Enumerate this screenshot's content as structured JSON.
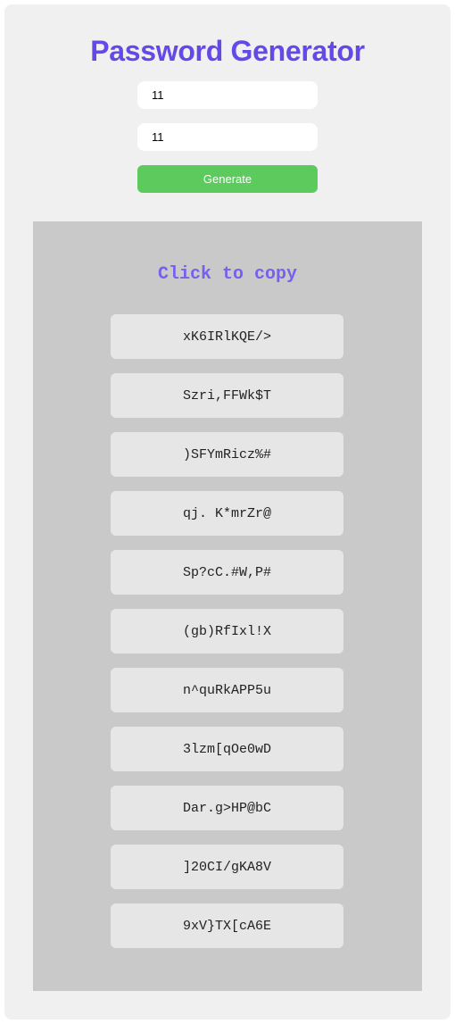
{
  "app": {
    "title": "Password Generator"
  },
  "form": {
    "length_value": "11",
    "count_value": "11",
    "generate_label": "Generate"
  },
  "results": {
    "heading": "Click to copy",
    "passwords": [
      "xK6IRlKQE/>",
      "Szri,FFWk$T",
      ")SFYmRicz%#",
      "qj. K*mrZr@",
      "Sp?cC.#W,P#",
      "(gb)RfIxl!X",
      "n^quRkAPP5u",
      "3lzm[qOe0wD",
      "Dar.g>HP@bC",
      "]20CI/gKA8V",
      "9xV}TX[cA6E"
    ]
  },
  "colors": {
    "title": "#6549e6",
    "heading": "#7561ec",
    "button": "#5dca5e",
    "card": "#f0f0f0",
    "panel": "#c9c9c9",
    "item": "#e6e6e6"
  }
}
